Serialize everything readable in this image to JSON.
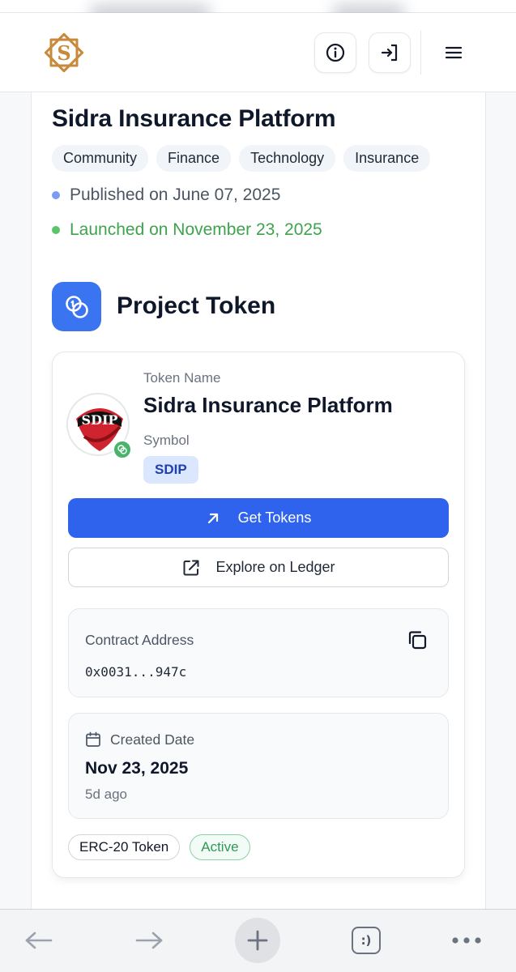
{
  "header": {
    "logo_letter": "S",
    "info_button": "info-icon",
    "login_button": "login-icon",
    "menu_button": "menu-icon"
  },
  "project": {
    "title": "Sidra Insurance Platform",
    "tags": [
      "Community",
      "Finance",
      "Technology",
      "Insurance"
    ],
    "published": "Published on June 07, 2025",
    "launched": "Launched on November 23, 2025"
  },
  "section": {
    "title": "Project Token"
  },
  "token": {
    "name_label": "Token Name",
    "name": "Sidra Insurance Platform",
    "symbol_label": "Symbol",
    "symbol": "SDIP",
    "logo_text": "SDIP",
    "get_tokens_label": "Get Tokens",
    "explore_label": "Explore on Ledger",
    "contract_label": "Contract Address",
    "contract_address": "0x0031...947c",
    "created_label": "Created Date",
    "created_date": "Nov 23, 2025",
    "created_ago": "5d ago",
    "standard_badge": "ERC-20 Token",
    "status_badge": "Active"
  },
  "browser_bar": {
    "tabs_label": ":)"
  },
  "colors": {
    "accent": "#2f63ee",
    "success": "#3fa34d",
    "icon_bg": "#3b74f0"
  }
}
